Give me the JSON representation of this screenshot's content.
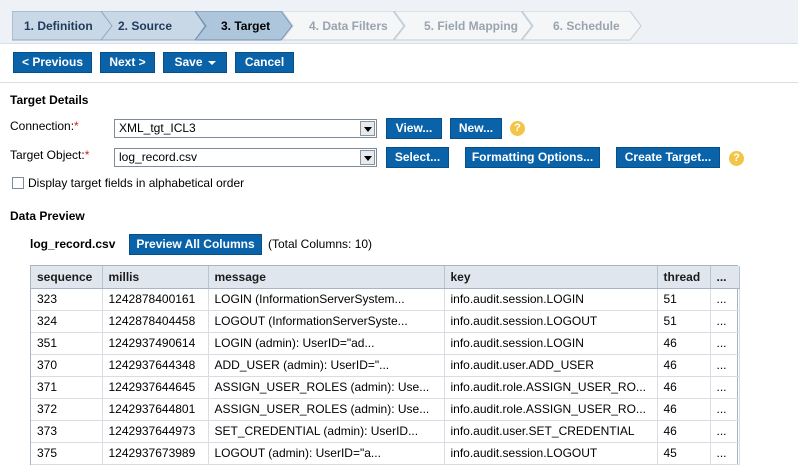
{
  "wizard": {
    "steps": [
      {
        "label": "1. Definition",
        "state": "done"
      },
      {
        "label": "2. Source",
        "state": "done"
      },
      {
        "label": "3. Target",
        "state": "current"
      },
      {
        "label": "4. Data Filters",
        "state": "todo"
      },
      {
        "label": "5. Field Mapping",
        "state": "todo"
      },
      {
        "label": "6. Schedule",
        "state": "todo"
      }
    ]
  },
  "toolbar": {
    "previous_label": "< Previous",
    "next_label": "Next >",
    "save_label": "Save",
    "cancel_label": "Cancel"
  },
  "target_details": {
    "title": "Target Details",
    "connection_label": "Connection:",
    "connection_value": "XML_tgt_ICL3",
    "view_label": "View...",
    "new_label": "New...",
    "target_object_label": "Target Object:",
    "target_object_value": "log_record.csv",
    "select_label": "Select...",
    "formatting_label": "Formatting Options...",
    "create_target_label": "Create Target...",
    "alpha_order_label": "Display target fields in alphabetical order",
    "required_mark": "*",
    "help_glyph": "?"
  },
  "data_preview": {
    "title": "Data Preview",
    "file_name": "log_record.csv",
    "preview_all_label": "Preview All Columns",
    "total_columns_text": "(Total Columns: 10)",
    "columns": [
      "sequence",
      "millis",
      "message",
      "key",
      "thread",
      "..."
    ],
    "rows": [
      [
        "323",
        "1242878400161",
        "LOGIN (InformationServerSystem...",
        "info.audit.session.LOGIN",
        "51",
        "..."
      ],
      [
        "324",
        "1242878404458",
        "LOGOUT (InformationServerSyste...",
        "info.audit.session.LOGOUT",
        "51",
        "..."
      ],
      [
        "351",
        "1242937490614",
        "LOGIN (admin): UserID=\"ad...",
        "info.audit.session.LOGIN",
        "46",
        "..."
      ],
      [
        "370",
        "1242937644348",
        "ADD_USER (admin): UserID=\"...",
        "info.audit.user.ADD_USER",
        "46",
        "..."
      ],
      [
        "371",
        "1242937644645",
        "ASSIGN_USER_ROLES (admin): Use...",
        "info.audit.role.ASSIGN_USER_RO...",
        "46",
        "..."
      ],
      [
        "372",
        "1242937644801",
        "ASSIGN_USER_ROLES (admin): Use...",
        "info.audit.role.ASSIGN_USER_RO...",
        "46",
        "..."
      ],
      [
        "373",
        "1242937644973",
        "SET_CREDENTIAL (admin): UserID...",
        "info.audit.user.SET_CREDENTIAL",
        "46",
        "..."
      ],
      [
        "375",
        "1242937673989",
        "LOGOUT (admin): UserID=\"a...",
        "info.audit.session.LOGOUT",
        "45",
        "..."
      ]
    ]
  },
  "colors": {
    "button": "#0a63a8",
    "wizard_done": "#c9d8e6",
    "wizard_current": "#aec6dc",
    "wizard_todo": "#f4f6f8",
    "grid_header": "#dfe6ee"
  }
}
